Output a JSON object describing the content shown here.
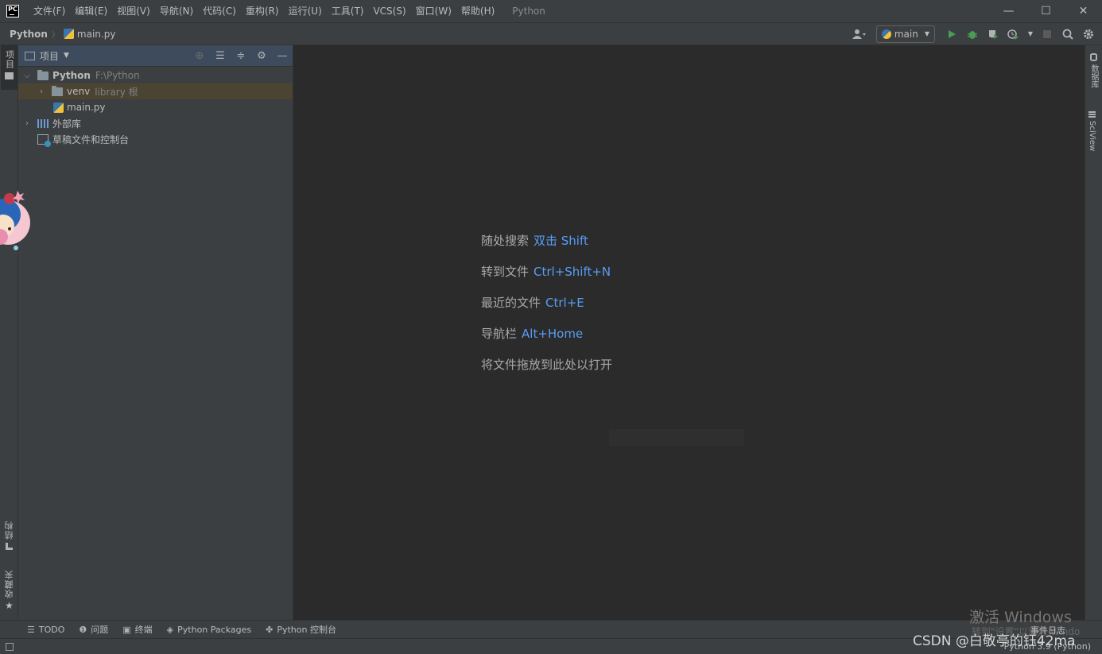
{
  "titlebar": {
    "logo_text": "PC",
    "menu": [
      "文件(F)",
      "编辑(E)",
      "视图(V)",
      "导航(N)",
      "代码(C)",
      "重构(R)",
      "运行(U)",
      "工具(T)",
      "VCS(S)",
      "窗口(W)",
      "帮助(H)"
    ],
    "window_title": "Python",
    "controls": {
      "minimize": "—",
      "maximize": "☐",
      "close": "✕"
    }
  },
  "navbar": {
    "project": "Python",
    "separator": "〉",
    "file": "main.py",
    "run_config": "main"
  },
  "left_strip": {
    "project_tab": "项目",
    "structure_tab": "结构",
    "favorites_tab": "收藏夹"
  },
  "project_panel": {
    "title": "项目",
    "tree": [
      {
        "label": "Python",
        "sub": "F:\\Python"
      },
      {
        "label": "venv",
        "sub": "library 根"
      },
      {
        "label": "main.py"
      },
      {
        "label": "外部库"
      },
      {
        "label": "草稿文件和控制台"
      }
    ]
  },
  "editor_hints": [
    {
      "text": "随处搜索",
      "key": "双击 Shift"
    },
    {
      "text": "转到文件",
      "key": "Ctrl+Shift+N"
    },
    {
      "text": "最近的文件",
      "key": "Ctrl+E"
    },
    {
      "text": "导航栏",
      "key": "Alt+Home"
    },
    {
      "text": "将文件拖放到此处以打开",
      "key": ""
    }
  ],
  "right_strip": {
    "database": "数据库",
    "sciview": "SciView"
  },
  "bottom_tabs": [
    "TODO",
    "问题",
    "终端",
    "Python Packages",
    "Python 控制台"
  ],
  "status": {
    "interpreter": "Python 3.9 (Python)",
    "event_log": "事件日志"
  },
  "overlay": {
    "activate_windows": "激活 Windows",
    "activate_sub": "转到\"设置\"以激活 Windo",
    "watermark": "CSDN @白敬亭的钰42ma"
  },
  "colors": {
    "background": "#2b2b2b",
    "panel": "#3c3f41",
    "hint_key": "#589df6",
    "selection": "#4b4433"
  }
}
